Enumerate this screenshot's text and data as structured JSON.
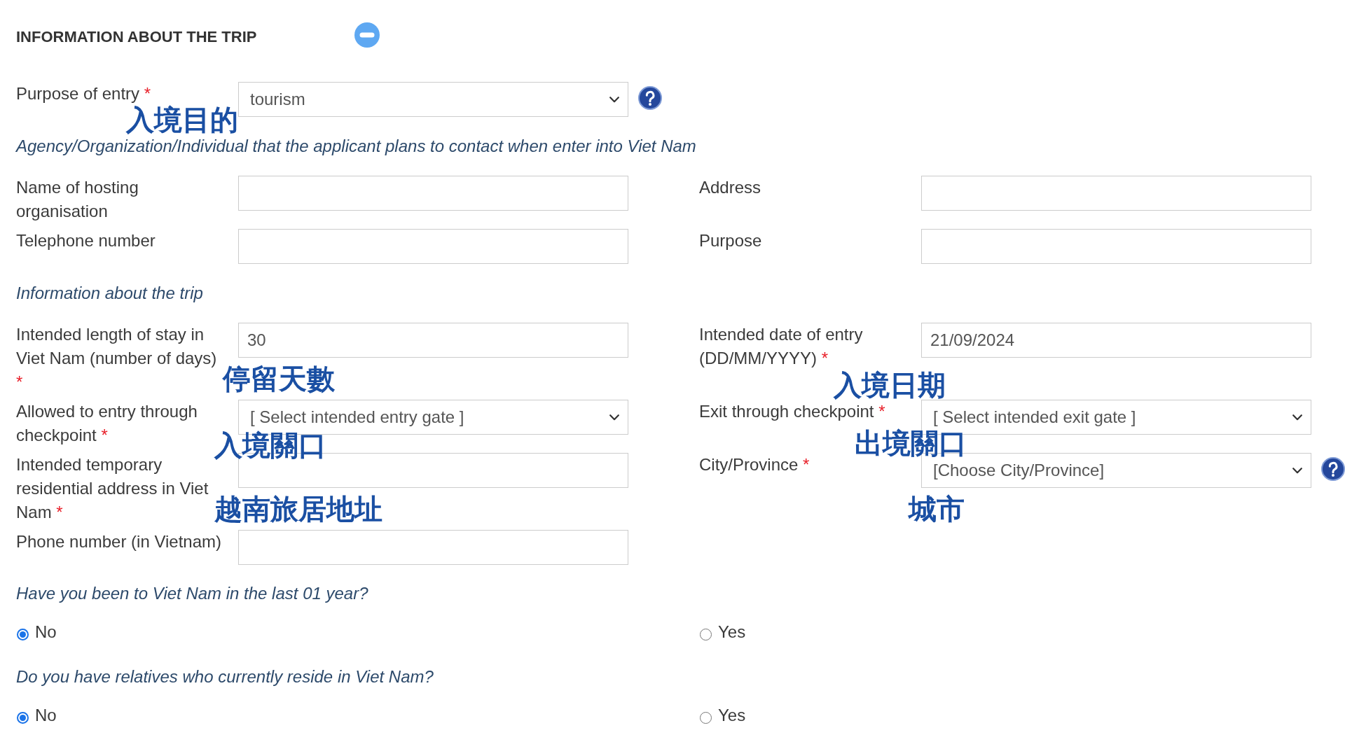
{
  "title": "INFORMATION ABOUT THE TRIP",
  "blocks": [
    {
      "kind": "fields",
      "cells": [
        {
          "label": "Purpose of entry",
          "required_mark": "*",
          "kind": "select",
          "value": "tourism",
          "help": true
        }
      ]
    },
    {
      "kind": "note",
      "text": "Agency/Organization/Individual that the applicant plans to contact when enter into Viet Nam"
    },
    {
      "kind": "fields",
      "cells": [
        {
          "label": "Name of hosting organisation",
          "kind": "text"
        },
        {
          "label": "Address",
          "kind": "text"
        }
      ]
    },
    {
      "kind": "fields",
      "cells": [
        {
          "label": "Telephone number",
          "kind": "text"
        },
        {
          "label": "Purpose",
          "kind": "text"
        }
      ]
    },
    {
      "kind": "note",
      "text": "Information about the trip"
    },
    {
      "kind": "fields",
      "cells": [
        {
          "label": "Intended length of stay in Viet Nam (number of days)",
          "required_mark": "*",
          "kind": "text",
          "value": "30"
        },
        {
          "label": "Intended date of entry (DD/MM/YYYY)",
          "required_mark": "*",
          "kind": "text",
          "value": "21/09/2024"
        }
      ]
    },
    {
      "kind": "fields",
      "cells": [
        {
          "label": "Allowed to entry through checkpoint",
          "required_mark": "*",
          "kind": "select",
          "value": "[ Select intended entry gate ]"
        },
        {
          "label": "Exit through checkpoint",
          "required_mark": "*",
          "kind": "select",
          "value": "[ Select intended exit gate ]"
        }
      ]
    },
    {
      "kind": "fields",
      "cells": [
        {
          "label": "Intended temporary residential address in Viet Nam",
          "required_mark": "*",
          "kind": "text"
        },
        {
          "label": "City/Province",
          "required_mark": "*",
          "kind": "select",
          "value": "[Choose City/Province]",
          "help": true
        }
      ]
    },
    {
      "kind": "fields",
      "cells": [
        {
          "label": "Phone number (in Vietnam)",
          "kind": "text"
        }
      ]
    },
    {
      "kind": "question",
      "text": "Have you been to Viet Nam in the last 01 year?",
      "options": [
        {
          "label": "No",
          "selected": true
        },
        {
          "label": "Yes",
          "selected": false
        }
      ]
    },
    {
      "kind": "question",
      "text": "Do you have relatives who currently reside in Viet Nam?",
      "options": [
        {
          "label": "No",
          "selected": true
        },
        {
          "label": "Yes",
          "selected": false
        }
      ]
    }
  ],
  "annotations": [
    "入境目的",
    "停留天數",
    "入境日期",
    "入境關口",
    "出境關口",
    "越南旅居地址",
    "城市"
  ]
}
